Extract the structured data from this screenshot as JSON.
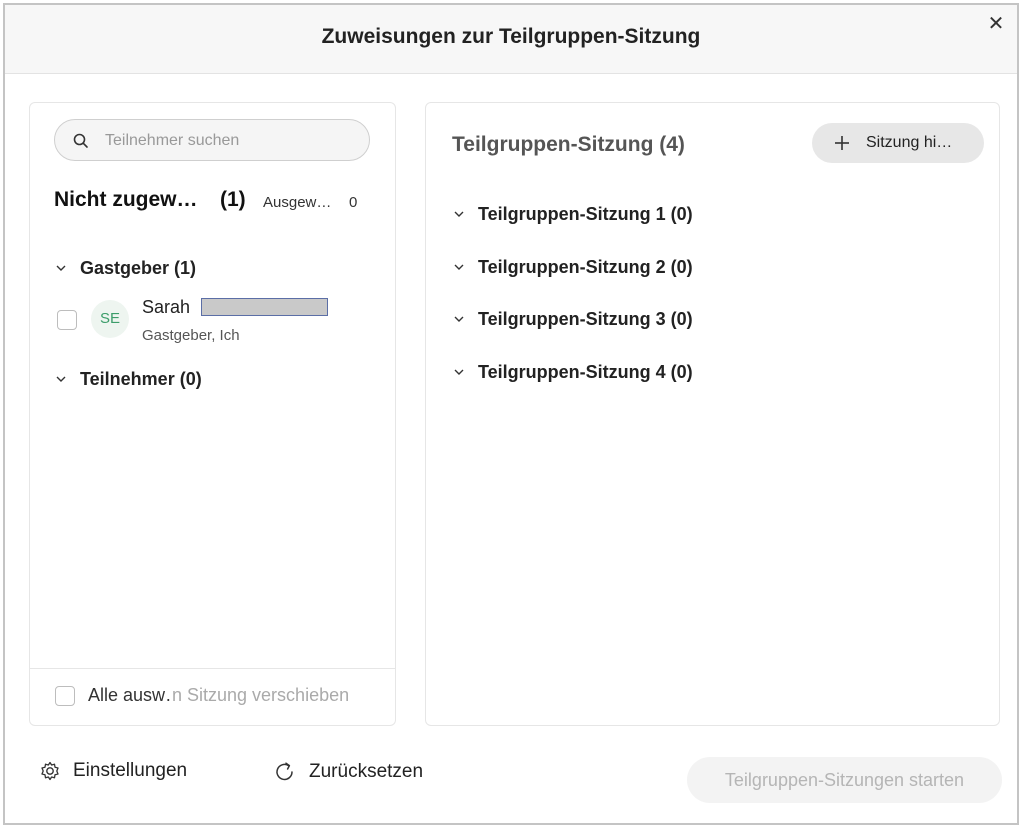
{
  "dialog": {
    "title": "Zuweisungen zur Teilgruppen-Sitzung"
  },
  "left_panel": {
    "search_placeholder": "Teilnehmer suchen",
    "unassigned_title": "Nicht zugew…",
    "unassigned_count": "(1)",
    "selected_label": "Ausgew…",
    "selected_count": "0",
    "groups": [
      {
        "label": "Gastgeber (1)",
        "members": [
          {
            "initials": "SE",
            "name": "Sarah",
            "role": "Gastgeber, Ich",
            "checked": false
          }
        ]
      },
      {
        "label": "Teilnehmer (0)",
        "members": []
      }
    ],
    "select_all_label": "Alle ausw…",
    "move_label": "n Sitzung verschieben"
  },
  "right_panel": {
    "title": "Teilgruppen-Sitzung (4)",
    "add_button_label": "Sitzung hi…",
    "sessions": [
      {
        "label": "Teilgruppen-Sitzung 1 (0)"
      },
      {
        "label": "Teilgruppen-Sitzung 2 (0)"
      },
      {
        "label": "Teilgruppen-Sitzung 3 (0)"
      },
      {
        "label": "Teilgruppen-Sitzung 4 (0)"
      }
    ]
  },
  "footer": {
    "settings_label": "Einstellungen",
    "reset_label": "Zurücksetzen",
    "start_label": "Teilgruppen-Sitzungen starten"
  },
  "colors": {
    "avatar_text": "#3c9d6a",
    "avatar_bg": "#eef5f0",
    "disabled_text": "#b5b5b5"
  }
}
